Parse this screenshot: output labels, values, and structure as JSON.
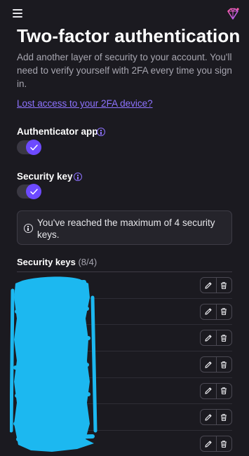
{
  "header": {
    "menu_icon": "hamburger-menu-icon",
    "logo_icon": "proton-gem-logo"
  },
  "page": {
    "title": "Two-factor authentication",
    "description": "Add another layer of security to your account. You'll need to verify yourself with 2FA every time you sign in.",
    "lost_access_link": "Lost access to your 2FA device?"
  },
  "settings": {
    "authenticator_app": {
      "label": "Authenticator app",
      "enabled": true
    },
    "security_key": {
      "label": "Security key",
      "enabled": true
    }
  },
  "notice": {
    "text": "You've reached the maximum of 4 security keys."
  },
  "security_keys": {
    "heading": "Security keys",
    "count": "(8/4)",
    "rows": [
      {
        "name": ""
      },
      {
        "name": ""
      },
      {
        "name": ""
      },
      {
        "name": ""
      },
      {
        "name": ""
      },
      {
        "name": ""
      },
      {
        "name": ""
      }
    ]
  },
  "colors": {
    "background": "#1b1a20",
    "accent": "#6d4aff",
    "link": "#8e73ff",
    "muted_text": "#a7a6b0",
    "redaction": "#1cb8f0"
  }
}
